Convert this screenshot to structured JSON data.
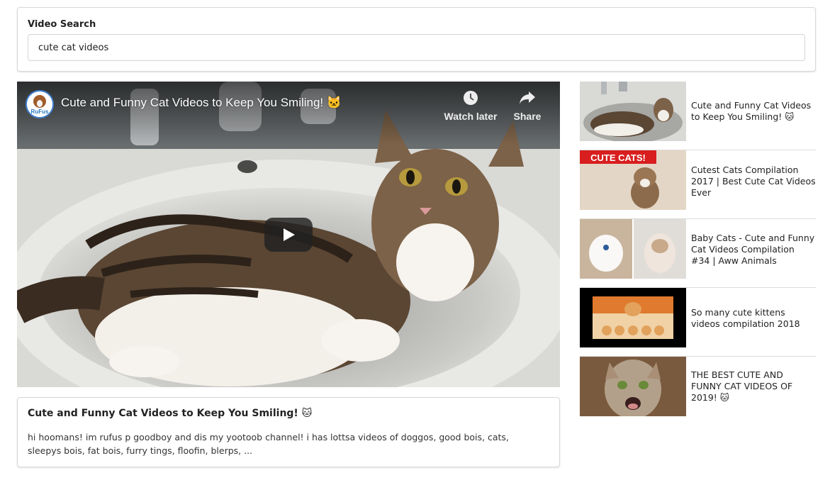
{
  "search": {
    "label": "Video Search",
    "value": "cute cat videos"
  },
  "player": {
    "title": "Cute and Funny Cat Videos to Keep You Smiling! 🐱",
    "channel_avatar_text": "RuFus",
    "watch_later_label": "Watch later",
    "share_label": "Share"
  },
  "selected_video": {
    "title": "Cute and Funny Cat Videos to Keep You Smiling! 🐱",
    "description": "hi hoomans! im rufus p goodboy and dis my yootoob channel! i has lottsa videos of doggos, good bois, cats, sleepys bois, fat bois, furry tings, floofin, blerps, ..."
  },
  "video_list": [
    {
      "title": "Cute and Funny Cat Videos to Keep You Smiling! 🐱"
    },
    {
      "title": "Cutest Cats Compilation 2017 | Best Cute Cat Videos Ever",
      "thumb_text": "CUTE CATS!"
    },
    {
      "title": "Baby Cats - Cute and Funny Cat Videos Compilation #34 | Aww Animals"
    },
    {
      "title": "So many cute kittens videos compilation 2018"
    },
    {
      "title": "THE BEST CUTE AND FUNNY CAT VIDEOS OF 2019! 🐱"
    }
  ],
  "colors": {
    "accent_blue": "#3f7fd0",
    "thumb_banner_red": "#d81e1e"
  },
  "icons": {
    "watch_later": "clock-icon",
    "share": "share-arrow-icon",
    "play": "play-icon"
  }
}
